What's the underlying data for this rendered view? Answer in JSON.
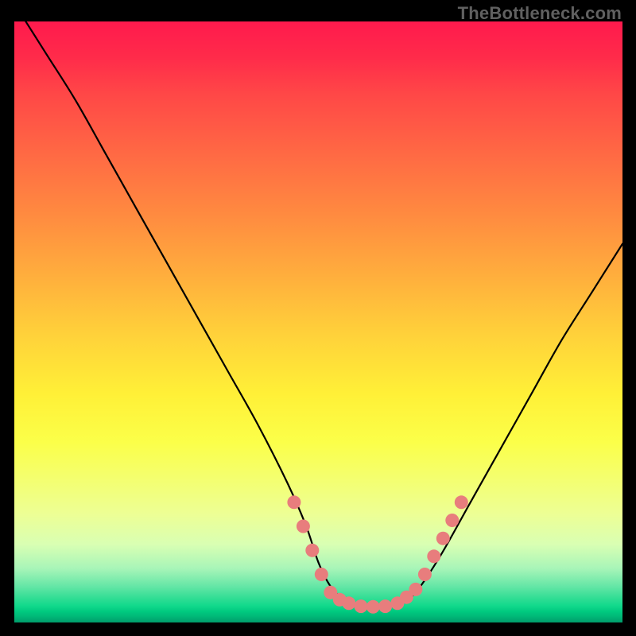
{
  "watermark": "TheBottleneck.com",
  "chart_data": {
    "type": "line",
    "title": "",
    "xlabel": "",
    "ylabel": "",
    "xlim": [
      0,
      100
    ],
    "ylim": [
      0,
      100
    ],
    "series": [
      {
        "name": "curve",
        "x": [
          0,
          5,
          10,
          15,
          20,
          25,
          30,
          35,
          40,
          45,
          48,
          50,
          52,
          54,
          56,
          58,
          60,
          62,
          64,
          66,
          70,
          75,
          80,
          85,
          90,
          95,
          100
        ],
        "values": [
          103,
          95,
          87,
          78,
          69,
          60,
          51,
          42,
          33,
          23,
          16,
          10,
          6,
          4,
          3,
          2.5,
          2.5,
          2.7,
          3.5,
          5,
          11,
          20,
          29,
          38,
          47,
          55,
          63
        ]
      }
    ],
    "markers": {
      "name": "salmon-dots",
      "color": "#e87d7d",
      "points": [
        {
          "x": 46,
          "y": 20
        },
        {
          "x": 47.5,
          "y": 16
        },
        {
          "x": 49,
          "y": 12
        },
        {
          "x": 50.5,
          "y": 8
        },
        {
          "x": 52,
          "y": 5
        },
        {
          "x": 53.5,
          "y": 3.8
        },
        {
          "x": 55,
          "y": 3.2
        },
        {
          "x": 57,
          "y": 2.7
        },
        {
          "x": 59,
          "y": 2.6
        },
        {
          "x": 61,
          "y": 2.7
        },
        {
          "x": 63,
          "y": 3.2
        },
        {
          "x": 64.5,
          "y": 4.2
        },
        {
          "x": 66,
          "y": 5.5
        },
        {
          "x": 67.5,
          "y": 8
        },
        {
          "x": 69,
          "y": 11
        },
        {
          "x": 70.5,
          "y": 14
        },
        {
          "x": 72,
          "y": 17
        },
        {
          "x": 73.5,
          "y": 20
        }
      ]
    },
    "gradient_stops": [
      {
        "pos": 0,
        "color": "#ff1a4d"
      },
      {
        "pos": 50,
        "color": "#ffd13a"
      },
      {
        "pos": 82,
        "color": "#edff95"
      },
      {
        "pos": 100,
        "color": "#009b6a"
      }
    ]
  }
}
